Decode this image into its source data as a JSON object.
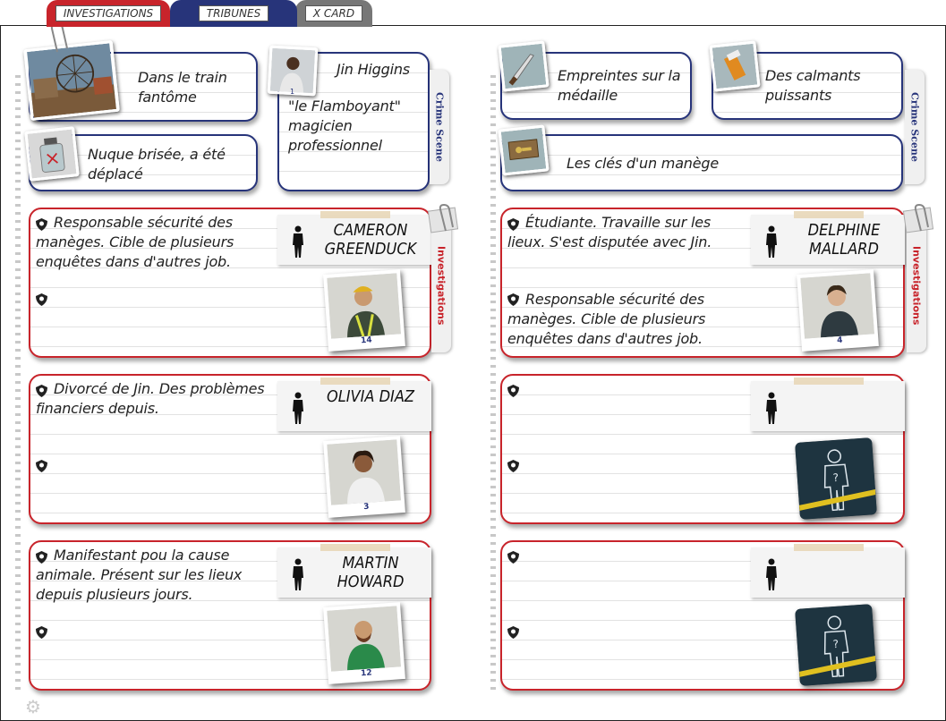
{
  "tabs": [
    {
      "label": "INVESTIGATIONS"
    },
    {
      "label": "TRIBUNES"
    },
    {
      "label": "X CARD"
    }
  ],
  "side_tabs": {
    "crime_scene": "Crime Scene",
    "investigations": "Investigations"
  },
  "left": {
    "crime_scene": {
      "clue1": "Dans le train fantôme",
      "clue2": "Nuque brisée, a été déplacé",
      "victim_name": "Jin Higgins",
      "victim_card_number": "1",
      "victim_desc": "\"le Flamboyant\" magicien professionnel"
    },
    "suspects": [
      {
        "name": "CAMERON GREENDUCK",
        "note1": "Responsable sécurité des manèges. Cible de plusieurs enquêtes dans d'autres job.",
        "note2": "",
        "card_number": "14"
      },
      {
        "name": "OLIVIA DIAZ",
        "note1": "Divorcé de Jin. Des problèmes financiers depuis.",
        "note2": "",
        "card_number": "3"
      },
      {
        "name": "MARTIN HOWARD",
        "note1": "Manifestant pou la cause animale. Présent sur les lieux depuis plusieurs jours.",
        "note2": "",
        "card_number": "12"
      }
    ]
  },
  "right": {
    "crime_scene": {
      "clue1": "Empreintes sur la médaille",
      "clue2": "Des calmants puissants",
      "clue3": "Les clés d'un manège"
    },
    "suspects": [
      {
        "name": "DELPHINE MALLARD",
        "note1": "Étudiante. Travaille sur les lieux. S'est disputée avec Jin.",
        "note2": "Responsable sécurité des manèges. Cible de plusieurs enquêtes dans d'autres job.",
        "card_number": "4"
      },
      {
        "name": "",
        "note1": "",
        "note2": "",
        "card_number": ""
      },
      {
        "name": "",
        "note1": "",
        "note2": "",
        "card_number": ""
      }
    ]
  },
  "colors": {
    "investigation_red": "#c8242b",
    "crime_scene_blue": "#27347a",
    "xcard_gray": "#777777"
  },
  "icons": [
    "paperclip-icon",
    "shield-icon",
    "silhouette-icon",
    "gear-icon",
    "unknown-suspect-icon"
  ]
}
